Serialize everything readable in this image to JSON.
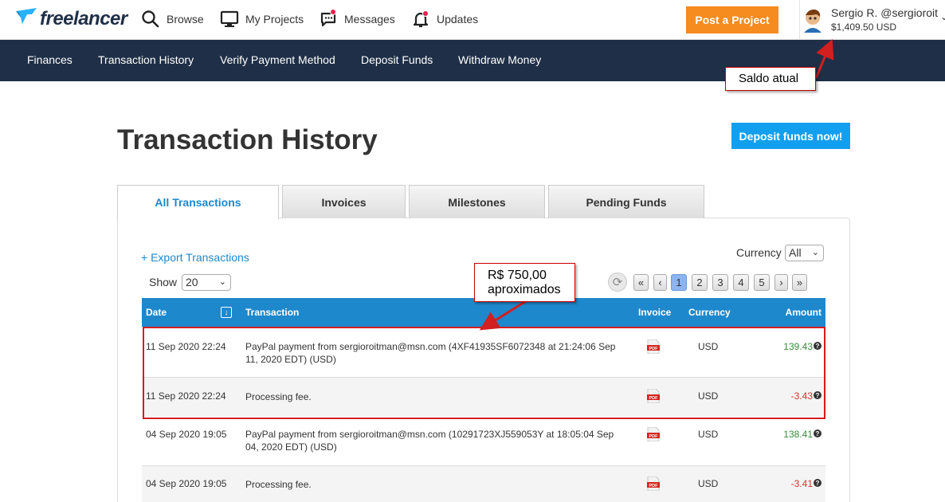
{
  "brand": {
    "name": "freelancer",
    "color": "#1f2f47",
    "accent": "#29b2fe"
  },
  "topnav": {
    "items": [
      {
        "label": "Browse",
        "icon": "search-icon"
      },
      {
        "label": "My Projects",
        "icon": "monitor-icon"
      },
      {
        "label": "Messages",
        "icon": "chat-icon"
      },
      {
        "label": "Updates",
        "icon": "bell-icon"
      }
    ],
    "post_label": "Post a Project",
    "post_color": "#f68b1f"
  },
  "user": {
    "name": "Sergio R. @sergioroit",
    "balance": "$1,409.50 USD"
  },
  "subnav": {
    "items": [
      "Finances",
      "Transaction History",
      "Verify Payment Method",
      "Deposit Funds",
      "Withdraw Money"
    ],
    "bg_color": "#1f2f47"
  },
  "annotations": {
    "saldo": "Saldo atual",
    "rs_line1": "R$ 750,00",
    "rs_line2": "aproximados",
    "color": "#d21f1f"
  },
  "page": {
    "title": "Transaction History",
    "deposit_label": "Deposit funds now!",
    "deposit_color": "#139ff0"
  },
  "tabs": [
    "All Transactions",
    "Invoices",
    "Milestones",
    "Pending Funds"
  ],
  "controls": {
    "export_label": "+ Export Transactions",
    "show_label": "Show",
    "show_value": "20",
    "currency_label": "Currency",
    "currency_value": "All"
  },
  "pager": {
    "first": "«",
    "prev": "‹",
    "pages": [
      "1",
      "2",
      "3",
      "4",
      "5"
    ],
    "next": "›",
    "last": "»",
    "current": "1"
  },
  "table": {
    "headers": {
      "date": "Date",
      "transaction": "Transaction",
      "invoice": "Invoice",
      "currency": "Currency",
      "amount": "Amount"
    },
    "header_color": "#1e88cc",
    "rows": [
      {
        "date": "11 Sep 2020 22:24",
        "transaction": "PayPal payment from sergioroitman@msn.com (4XF41935SF6072348 at 21:24:06 Sep 11, 2020 EDT) (USD)",
        "invoice": "PDF",
        "currency": "USD",
        "amount": "139.43"
      },
      {
        "date": "11 Sep 2020 22:24",
        "transaction": "Processing fee.",
        "invoice": "PDF",
        "currency": "USD",
        "amount": "-3.43"
      },
      {
        "date": "04 Sep 2020 19:05",
        "transaction": "PayPal payment from sergioroitman@msn.com (10291723XJ559053Y at 18:05:04 Sep 04, 2020 EDT) (USD)",
        "invoice": "PDF",
        "currency": "USD",
        "amount": "138.41"
      },
      {
        "date": "04 Sep 2020 19:05",
        "transaction": "Processing fee.",
        "invoice": "PDF",
        "currency": "USD",
        "amount": "-3.41"
      }
    ]
  }
}
